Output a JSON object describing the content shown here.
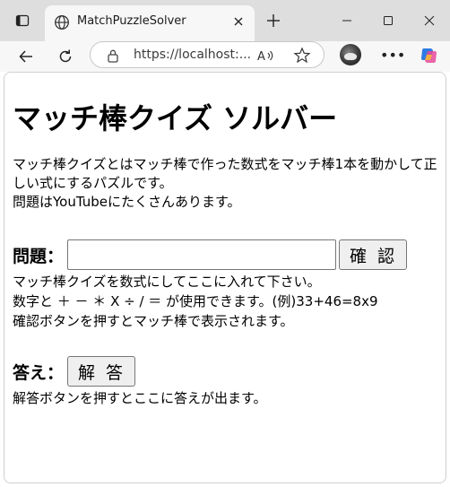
{
  "browser": {
    "tab_title": "MatchPuzzleSolver",
    "url": "https://localhost:..."
  },
  "page": {
    "title": "マッチ棒クイズ ソルバー",
    "intro_line1": "マッチ棒クイズとはマッチ棒で作った数式をマッチ棒1本を動かして正しい式にするパズルです。",
    "intro_line2": "問題はYouTubeにたくさんあります。",
    "question_label": "問題：",
    "question_value": "",
    "confirm_button": "確認",
    "question_help1": "マッチ棒クイズを数式にしてここに入れて下さい。",
    "question_help2": "数字と ＋ － ＊ X ÷ / ＝ が使用できます。(例)33+46=8x9",
    "question_help3": "確認ボタンを押すとマッチ棒で表示されます。",
    "answer_label": "答え：",
    "answer_button": "解答",
    "answer_help": "解答ボタンを押すとここに答えが出ます。"
  }
}
